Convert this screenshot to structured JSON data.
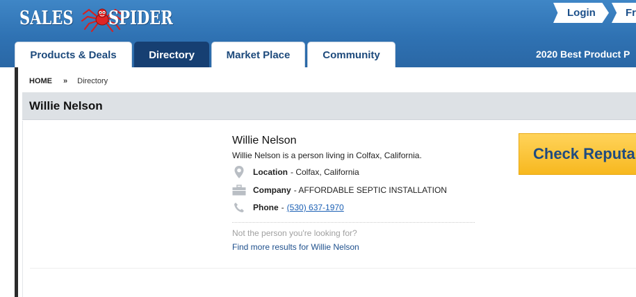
{
  "logo": {
    "left_word": "SALES",
    "right_word": "SPIDER",
    "icon": "spider-icon"
  },
  "header_buttons": {
    "login": "Login",
    "free": "Fre"
  },
  "tabs": [
    {
      "label": "Products & Deals",
      "active": false
    },
    {
      "label": "Directory",
      "active": true
    },
    {
      "label": "Market Place",
      "active": false
    },
    {
      "label": "Community",
      "active": false
    }
  ],
  "promo": "2020 Best Product P",
  "breadcrumb": {
    "home": "HOME",
    "separator": "»",
    "current": "Directory"
  },
  "page_title": "Willie Nelson",
  "person": {
    "name": "Willie Nelson",
    "description": "Willie Nelson is a person living in Colfax, California.",
    "location_label": "Location",
    "location_value": "- Colfax, California",
    "company_label": "Company",
    "company_value": "- AFFORDABLE SEPTIC INSTALLATION",
    "phone_label": "Phone",
    "phone_dash": "-",
    "phone_value": "(530) 637-1970"
  },
  "not_person_text": "Not the person you're looking for?",
  "find_more_text": "Find more results for Willie Nelson",
  "check_button": "Check Reputa",
  "colors": {
    "header_blue": "#2f72b3",
    "active_tab": "#163f72",
    "link_blue": "#1a5fb4",
    "check_button_yellow": "#f7b81f"
  }
}
